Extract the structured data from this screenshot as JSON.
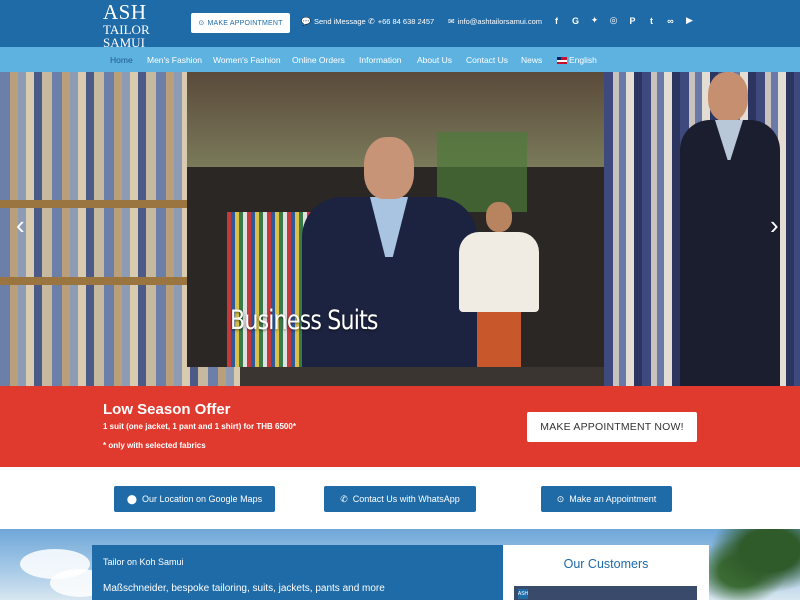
{
  "header": {
    "logo": {
      "line1": "ASH",
      "line2": "TAILOR",
      "line3": "SAMUI"
    },
    "appointment_button": {
      "icon": "clock-icon",
      "label": "MAKE APPOINTMENT"
    },
    "imessage": {
      "icon": "chat-bubble-icon",
      "label": "Send iMessage"
    },
    "phone": {
      "icon": "whatsapp-icon",
      "label": "+66 84 638 2457"
    },
    "email": {
      "icon": "envelope-icon",
      "label": "info@ashtailorsamui.com"
    },
    "socials": [
      {
        "name": "facebook-icon",
        "glyph": "f"
      },
      {
        "name": "google-icon",
        "glyph": "G"
      },
      {
        "name": "twitter-icon",
        "glyph": "🐦"
      },
      {
        "name": "instagram-icon",
        "glyph": "◎"
      },
      {
        "name": "pinterest-icon",
        "glyph": "P"
      },
      {
        "name": "tumblr-icon",
        "glyph": "t"
      },
      {
        "name": "tripadvisor-icon",
        "glyph": "◉◉"
      },
      {
        "name": "youtube-icon",
        "glyph": "▶"
      }
    ]
  },
  "nav": {
    "items": [
      {
        "label": "Home",
        "active": true
      },
      {
        "label": "Men's Fashion"
      },
      {
        "label": "Women's Fashion"
      },
      {
        "label": "Online Orders"
      },
      {
        "label": "Information"
      },
      {
        "label": "About Us"
      },
      {
        "label": "Contact Us"
      },
      {
        "label": "News"
      },
      {
        "label": "English",
        "flag": "uk-flag-icon"
      }
    ]
  },
  "slider": {
    "caption": "Business Suits",
    "prev_icon": "chevron-left-icon",
    "next_icon": "chevron-right-icon"
  },
  "offer": {
    "title": "Low Season Offer",
    "line": "1 suit (one jacket, 1 pant and 1 shirt) for THB 6500*",
    "note": "* only with selected fabrics",
    "button": "MAKE APPOINTMENT NOW!"
  },
  "actions": [
    {
      "icon": "map-marker-icon",
      "label": "Our Location on Google Maps"
    },
    {
      "icon": "whatsapp-icon",
      "label": "Contact Us with WhatsApp"
    },
    {
      "icon": "clock-icon",
      "label": "Make an Appointment"
    }
  ],
  "info": {
    "title": "Tailor on Koh Samui",
    "subtitle": "Maßschneider, bespoke tailoring, suits, jackets, pants and more"
  },
  "customers": {
    "title": "Our Customers",
    "badge": "ASH"
  },
  "colors": {
    "brand_blue": "#1e6ba8",
    "nav_blue": "#5eb2e0",
    "offer_red": "#e03a2f"
  }
}
